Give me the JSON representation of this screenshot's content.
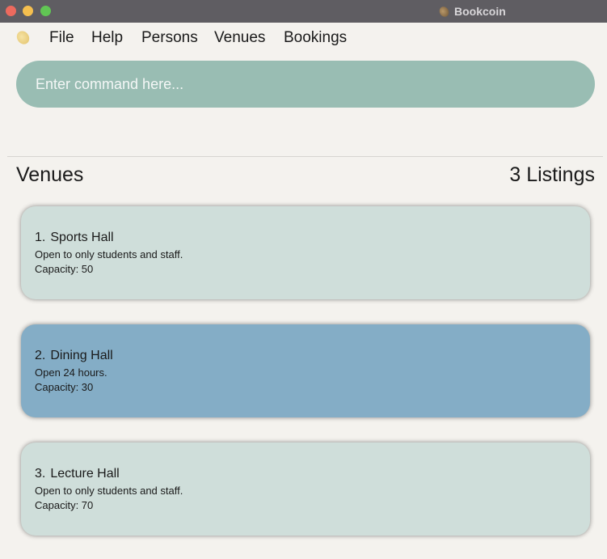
{
  "window": {
    "title": "Bookcoin",
    "icon": "coin-icon"
  },
  "menu": {
    "app_icon": "coin-icon",
    "items": [
      "File",
      "Help",
      "Persons",
      "Venues",
      "Bookings"
    ]
  },
  "command": {
    "placeholder": "Enter command here...",
    "value": ""
  },
  "list": {
    "title": "Venues",
    "count_label": "3 Listings",
    "venues": [
      {
        "index": "1.",
        "name": "Sports Hall",
        "description": "Open to only students and staff.",
        "capacity": "Capacity: 50",
        "selected": false
      },
      {
        "index": "2.",
        "name": "Dining Hall",
        "description": "Open 24 hours.",
        "capacity": "Capacity: 30",
        "selected": true
      },
      {
        "index": "3.",
        "name": "Lecture Hall",
        "description": "Open to only students and staff.",
        "capacity": "Capacity: 70",
        "selected": false
      }
    ]
  },
  "colors": {
    "command_bg": "#99bdb3",
    "card_bg": "#cfdeda",
    "card_selected_bg": "#84adc6"
  }
}
